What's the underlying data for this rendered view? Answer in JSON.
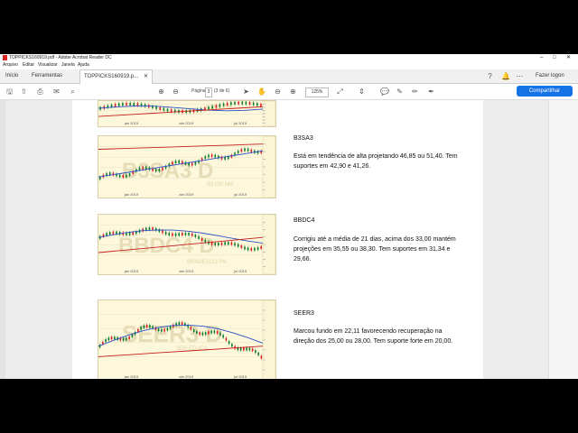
{
  "window": {
    "title": "TOPPICKS160919.pdf - Adobe Acrobat Reader DC"
  },
  "menu": [
    "Arquivo",
    "Editar",
    "Visualizar",
    "Janela",
    "Ajuda"
  ],
  "tabs": {
    "home": "Início",
    "tools": "Ferramentas",
    "document": "TOPPICKS160919.p..."
  },
  "header_right": {
    "signin": "Fazer logon"
  },
  "toolbar": {
    "page_label": "Página",
    "page_current": "3",
    "page_total": "(3 de 6)",
    "zoom": "125%",
    "share": "Compartilhar"
  },
  "stocks": [
    {
      "ticker": "B3SA3",
      "watermark": "B3SA3 D",
      "brand": "B3 ON NM",
      "months": [
        "jan 2019",
        "abr 2019",
        "jul 2019"
      ],
      "description": "Está em tendência de alta projetando 46,85 ou 51,40. Tem suportes em 42,90 e 41,26."
    },
    {
      "ticker": "BBDC4",
      "watermark": "BBDC4 D",
      "brand": "BRADESCO PN",
      "months": [
        "jan 2019",
        "abr 2019",
        "jul 2019"
      ],
      "description": "Corrigiu até a média de 21 dias, acima dos 33,00 mantém projeções em 35,55 ou 38,30. Tem suportes em 31,34 e 29,66."
    },
    {
      "ticker": "SEER3",
      "watermark": "SEER3 D",
      "brand": "SER EDUCA",
      "months": [
        "jan 2019",
        "abr 2019",
        "jul 2019"
      ],
      "description": "Marcou fundo em 22,11 favorecendo recuperação na direção dos 25,00 ou 28,00. Tem suporte forte em 20,00."
    }
  ],
  "top_chart": {
    "brand": "AZUL PN",
    "months": [
      "jan 2019",
      "abr 2019",
      "jul 2019"
    ]
  },
  "colors": {
    "accent": "#1473e6",
    "chart_bg": "#fdf7dc",
    "candle_up": "#0a7a2a",
    "candle_down": "#d81e1e",
    "ma_short": "#2a54c8",
    "ma_long": "#c81e1e"
  }
}
